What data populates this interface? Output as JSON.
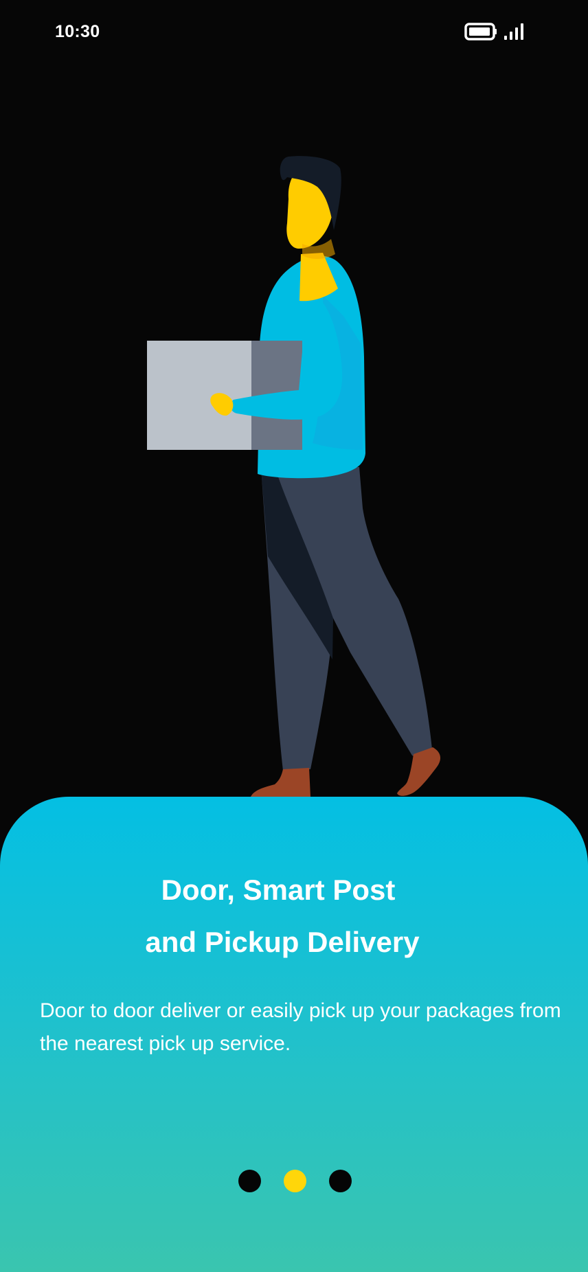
{
  "status_bar": {
    "time": "10:30",
    "icons": [
      "battery-icon",
      "signal-icon"
    ]
  },
  "illustration": {
    "subject": "delivery-person-carrying-box-icon"
  },
  "onboarding": {
    "title_line1": "Door, Smart Post",
    "title_line2": "and Pickup Delivery",
    "description": "Door to door deliver or easily pick up your packages from the nearest pick up service."
  },
  "pager": {
    "dot_count": 3,
    "active_index": 1
  },
  "colors": {
    "background": "#060606",
    "card_gradient_top": "#04BFE3",
    "card_gradient_bottom": "#3AC5AF",
    "dot_inactive": "#050505",
    "dot_active": "#FFD60A",
    "shirt": "#00BDE3",
    "pants": "#384255",
    "skin": "#FFCC00",
    "hair": "#141C28",
    "box_front": "#BBC2CA",
    "box_side": "#6B7484",
    "feet": "#9B4526"
  }
}
